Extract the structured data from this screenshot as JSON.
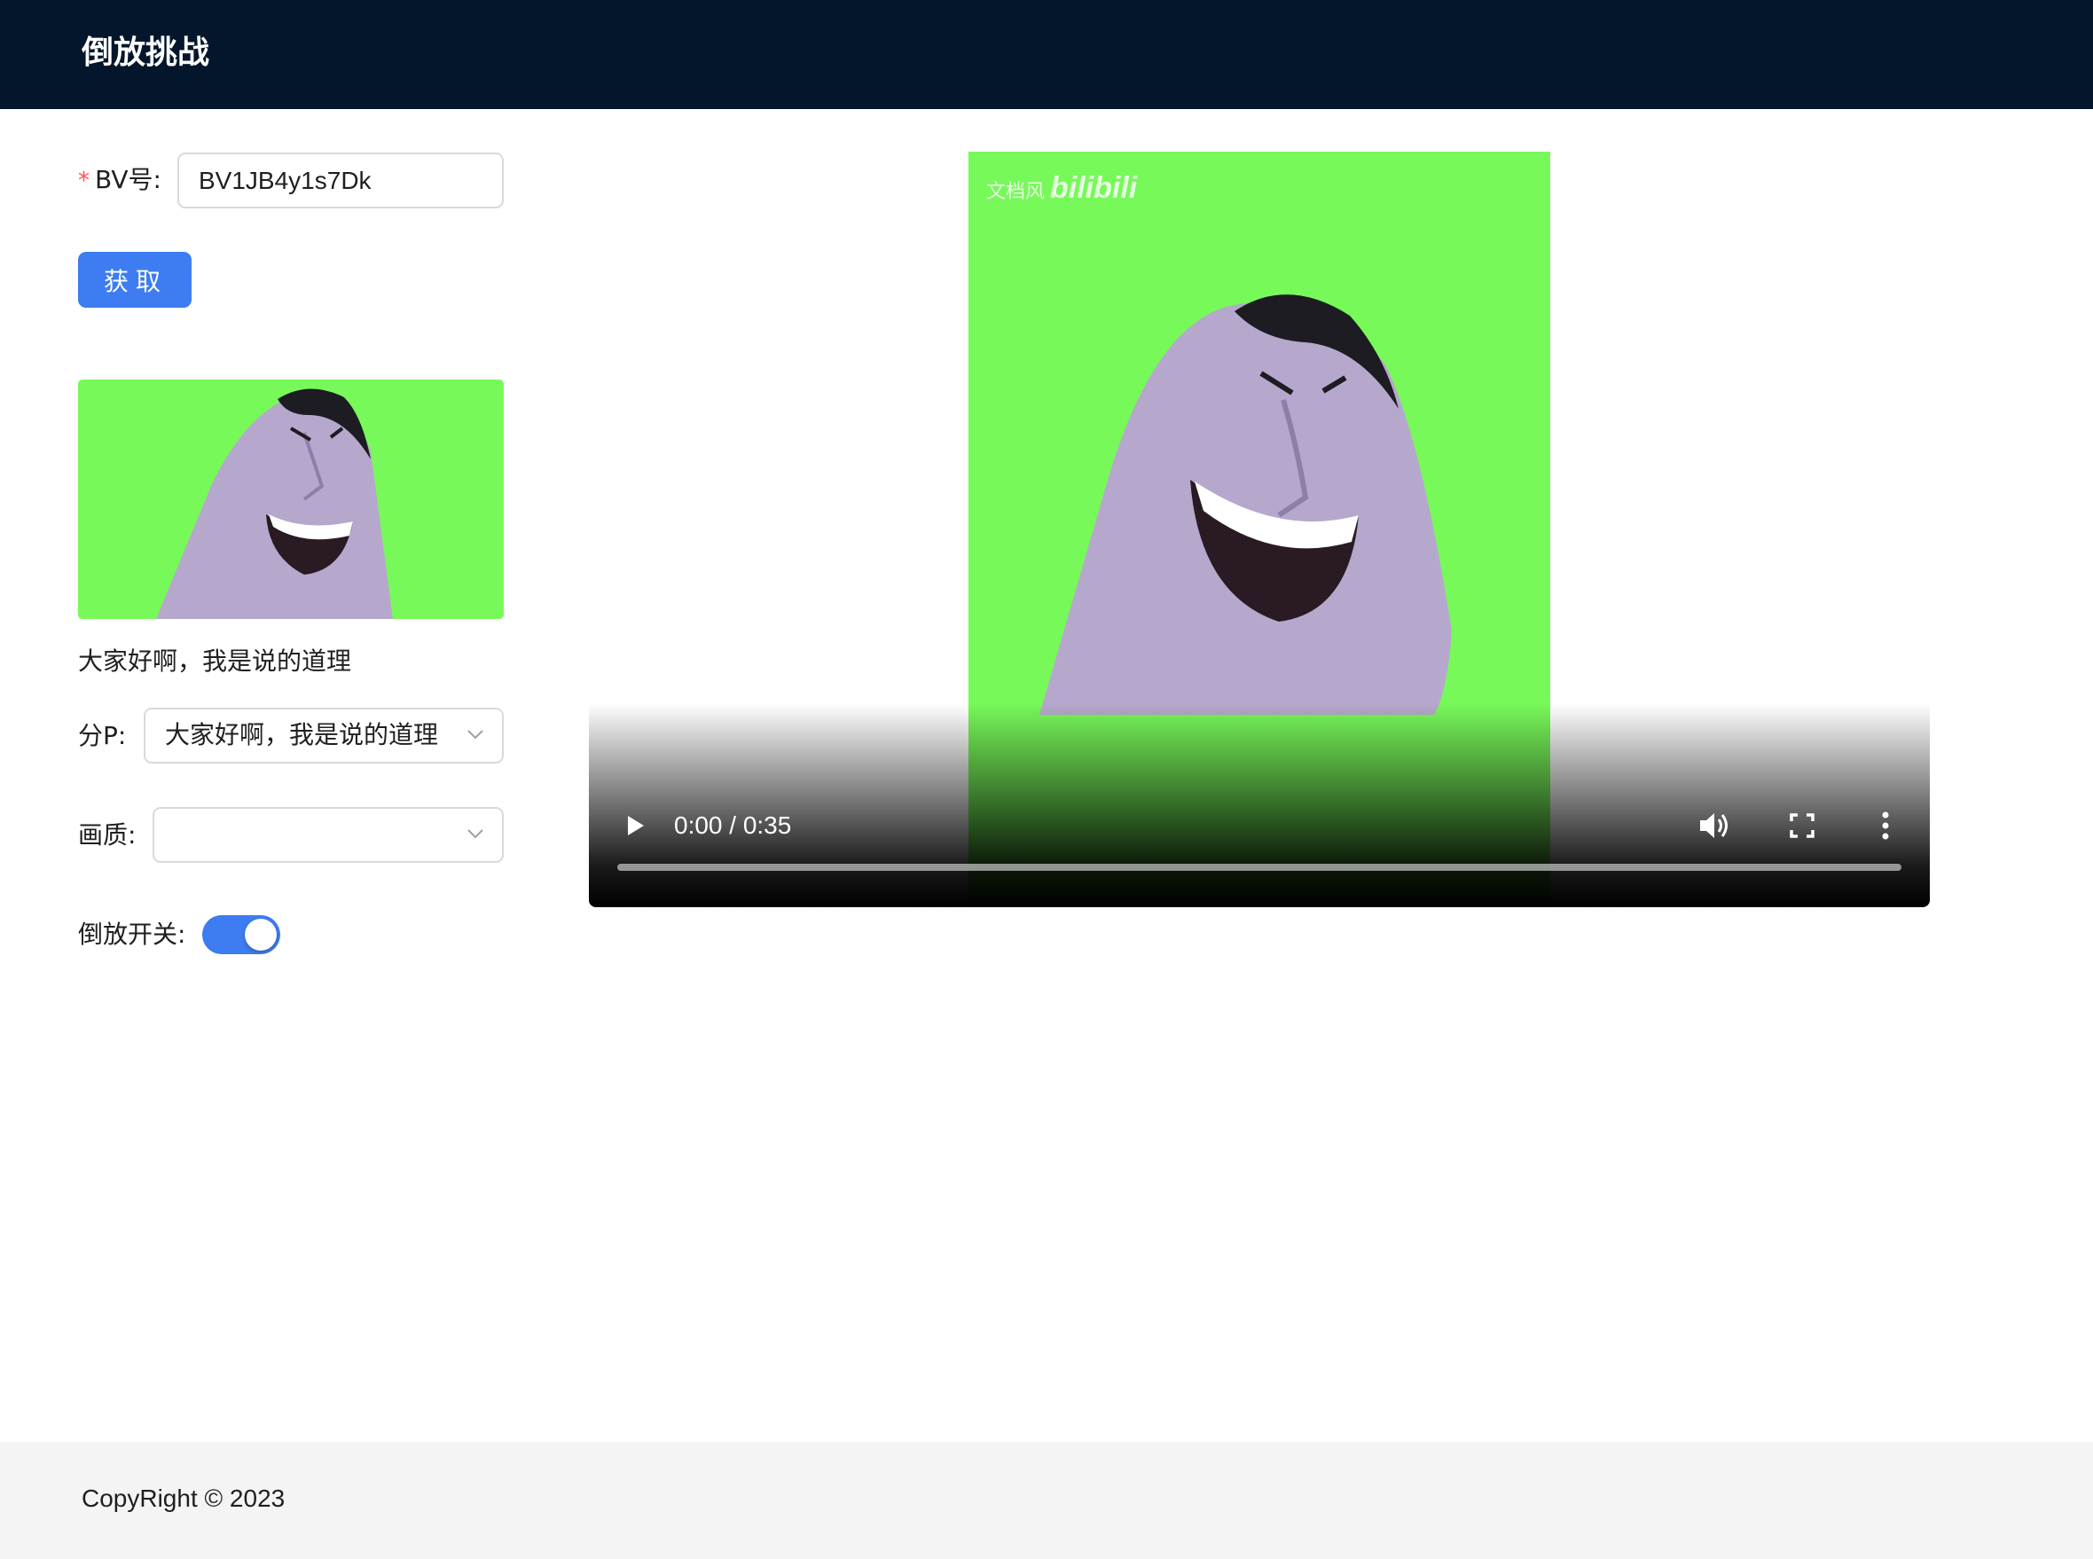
{
  "header": {
    "title": "倒放挑战"
  },
  "form": {
    "bv_label": "BV号:",
    "bv_value": "BV1JB4y1s7Dk",
    "fetch_button": "获取",
    "video_title": "大家好啊，我是说的道理",
    "part_label": "分P:",
    "part_value": "大家好啊，我是说的道理",
    "quality_label": "画质:",
    "quality_value": "",
    "reverse_label": "倒放开关:",
    "reverse_on": true
  },
  "player": {
    "time": "0:00 / 0:35",
    "progress": 0,
    "watermark": "文档风",
    "watermark_logo": "bilibili"
  },
  "footer": {
    "text": "CopyRight © 2023"
  },
  "colors": {
    "header_bg": "#03162b",
    "primary": "#3d7cf1",
    "green_screen": "#78f95a",
    "footer_bg": "#f4f4f4"
  }
}
